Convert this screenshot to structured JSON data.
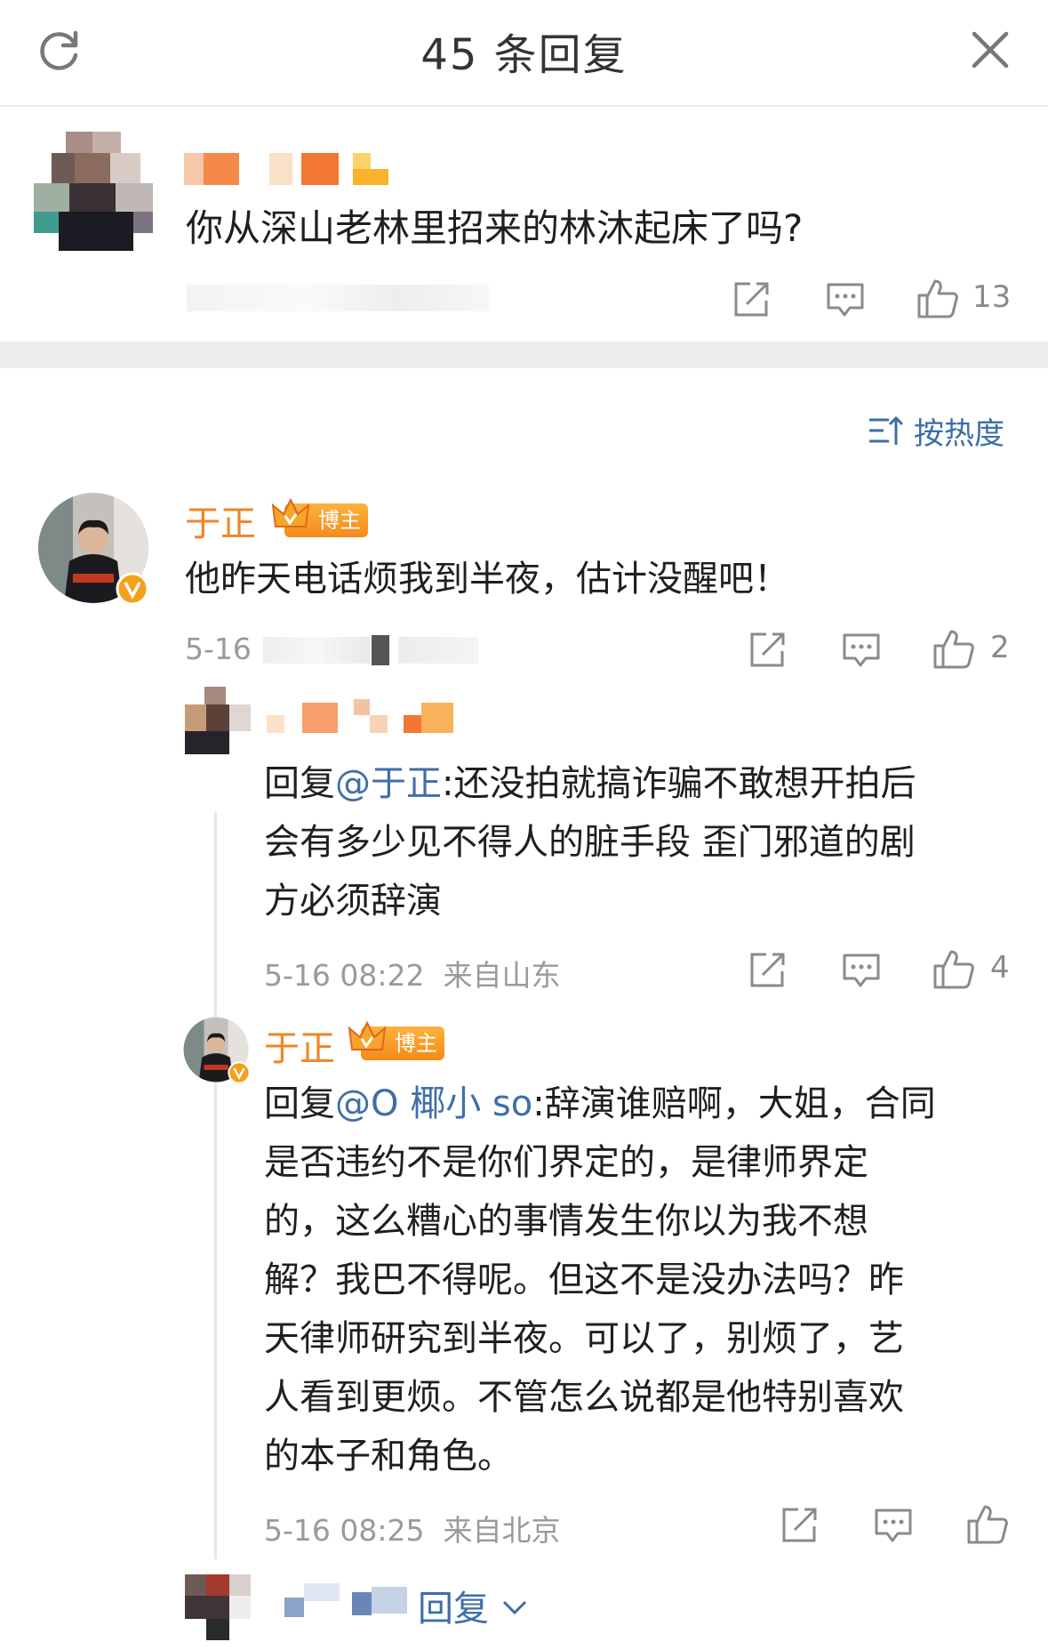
{
  "header": {
    "title": "45 条回复",
    "refresh_icon": "refresh-icon",
    "close_icon": "close-icon"
  },
  "root_comment": {
    "text": "你从深山老林里招来的林沐起床了吗?",
    "likes": "13"
  },
  "sort": {
    "label": "按热度",
    "icon": "sort-icon"
  },
  "comments": [
    {
      "author": "于正",
      "badge": "博主",
      "text": "他昨天电话烦我到半夜，估计没醒吧！",
      "meta": "5-16",
      "likes": "2"
    },
    {
      "reply_prefix": "回复",
      "mention": "@于正",
      "text_lines": [
        ":还没拍就搞诈骗不敢想开拍后",
        "会有多少见不得人的脏手段 歪门邪道的剧",
        "方必须辞演"
      ],
      "time": "5-16 08:22",
      "location": "来自山东",
      "likes": "4"
    },
    {
      "author": "于正",
      "badge": "博主",
      "reply_prefix": "回复",
      "mention": "@O 椰小 so",
      "text_lines": [
        ":辞演谁赔啊，大姐，合同",
        "是否违约不是你们界定的，是律师界定",
        "的，这么糟心的事情发生你以为我不想",
        "解？我巴不得呢。但这不是没办法吗？昨",
        "天律师研究到半夜。可以了，别烦了，艺",
        "人看到更烦。不管怎么说都是他特别喜欢",
        "的本子和角色。"
      ],
      "time": "5-16 08:25",
      "location": "来自北京"
    }
  ],
  "more_replies": {
    "label": "回复"
  },
  "colors": {
    "accent_blue": "#3f6ea8",
    "orange": "#f18424",
    "meta_gray": "#9a9a9a"
  }
}
